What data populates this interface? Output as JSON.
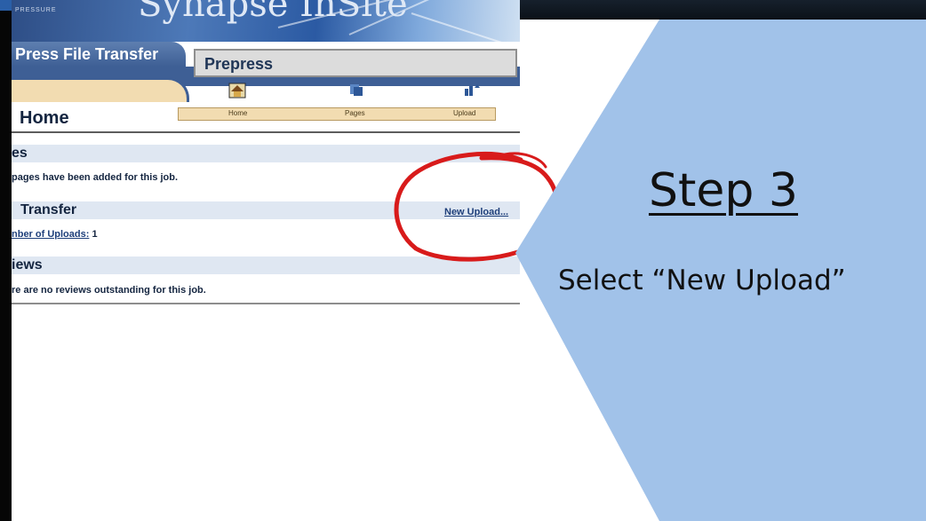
{
  "app": {
    "banner_brand_small": "PRESSURE",
    "banner_title": "Synapse InSite",
    "section_tab": "Press File Transfer",
    "job_name": "Prepress"
  },
  "nav": {
    "items": [
      {
        "label": "Home",
        "icon": "home-icon"
      },
      {
        "label": "Pages",
        "icon": "pages-icon"
      },
      {
        "label": "Upload",
        "icon": "upload-icon"
      }
    ]
  },
  "page": {
    "title": "Home"
  },
  "sections": {
    "pages": {
      "header": "es",
      "text": "pages have been added for this job."
    },
    "transfer": {
      "header": "Transfer",
      "new_upload_link": "New Upload...",
      "uploads_label": "nber of Uploads:",
      "uploads_value": "1"
    },
    "reviews": {
      "header": "iews",
      "text": "re are no reviews outstanding for this job."
    }
  },
  "instruction": {
    "step_title": "Step 3",
    "step_text": "Select “New Upload”"
  },
  "colors": {
    "chevron": "#a1c2e9",
    "highlight_circle": "#d81b1b",
    "nav_blue": "#3e5f95",
    "nav_cream": "#f2dcb1",
    "section_band": "#dfe7f2"
  }
}
